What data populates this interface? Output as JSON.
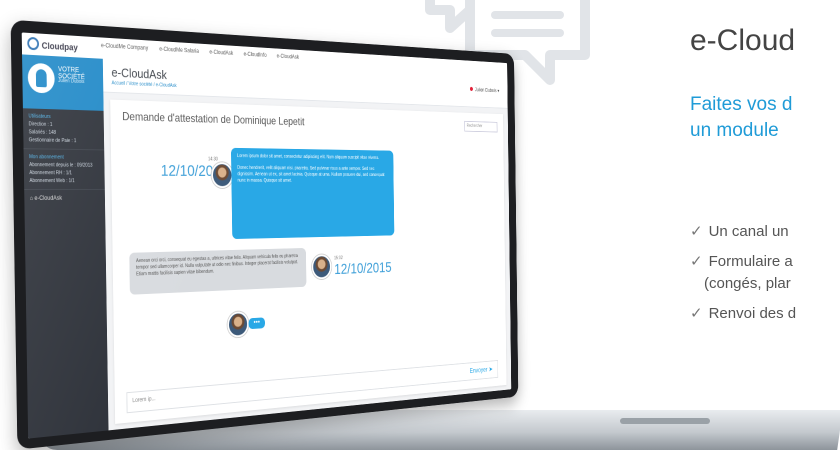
{
  "marketing": {
    "title": "e-Cloud",
    "subtitle_line1": "Faites vos d",
    "subtitle_line2": "un module",
    "features": [
      {
        "line1": "Un canal un",
        "line2": ""
      },
      {
        "line1": "Formulaire a",
        "line2": "(congés, plar"
      },
      {
        "line1": "Renvoi des d",
        "line2": ""
      }
    ]
  },
  "app": {
    "logo": "Cloudpay",
    "tabs": [
      "e-CloudMe Company",
      "e-CloudMe Salaria",
      "e-CloudAsk",
      "e-CloudInfo",
      "e-CloudAsk"
    ],
    "sidebar": {
      "company": "VOTRE SOCIÉTÉ",
      "user": "Julien Dubois",
      "section1_title": "Utilisateurs",
      "section1_items": [
        "Direction : 1",
        "Salariés : 148",
        "Gestionnaire de Paie : 1"
      ],
      "section2_title": "Mon abonnement",
      "section2_items": [
        "Abonnement depuis le : 09/2013",
        "Abonnement RH : 1/1",
        "Abonnement Web : 1/1"
      ],
      "nav_item": "e-CloudAsk"
    },
    "header": {
      "title": "e-CloudAsk",
      "breadcrumb": "Accueil / Votre société / e-CloudAsk",
      "user": "Julien Dubois"
    },
    "request": {
      "title": "Demande d'attestation de Dominique Lepetit",
      "search_placeholder": "Rechercher",
      "msg1_date": "12/10/2015",
      "msg1_time": "14:30",
      "msg1_text_a": "Lorem ipsum dolor sit amet, consectetur adipiscing elit. Nam aliquam suscipit vitae viverra.",
      "msg1_text_b": "Donec hendrerit, velit aliquam nisi. pharetra. Sed pulvinar risus a ante semper. Sed nec dignissim. Aenean ut ex, sit amet lacinia. Quisque at urna. Nullam posuere dui, sed consequat nunc in massa. Quisque sit amet.",
      "msg2_date": "12/10/2015",
      "msg2_time": "15:02",
      "msg2_text": "Aenean orci orci, consequat eu egestas a, ultrices vitae felis. Aliquam vehicula felis eu pharetra tempor sed ullamcorper id. Nulla vulputate ut odio nec finibus. Integer placerat facilisis volutpat. Etiam mattis facilisis sapien vitae bibendum.",
      "typing": "•••",
      "composer_placeholder": "Lorem ip...",
      "send_label": "Envoyer"
    }
  },
  "colors": {
    "accent": "#1f9bd7",
    "bubble": "#29a8e6",
    "sidebar": "#2c3038"
  }
}
